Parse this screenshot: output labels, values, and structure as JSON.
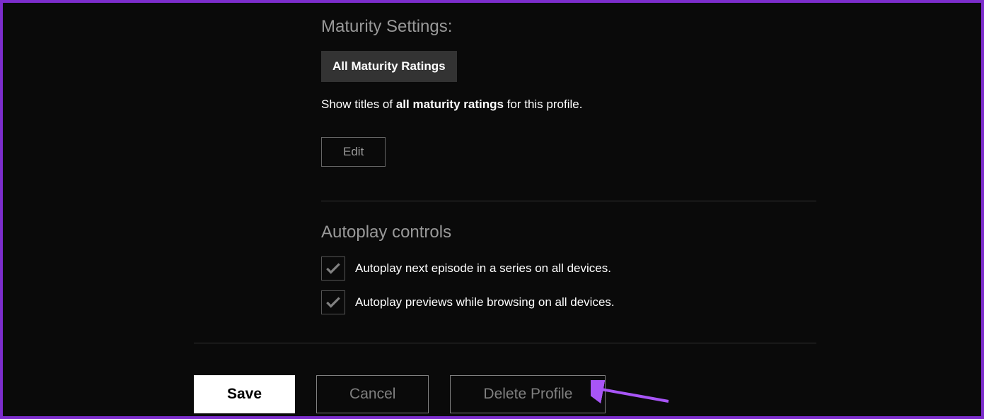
{
  "maturity": {
    "title": "Maturity Settings:",
    "badge": "All Maturity Ratings",
    "desc_prefix": "Show titles of ",
    "desc_strong": "all maturity ratings",
    "desc_suffix": " for this profile.",
    "edit": "Edit"
  },
  "autoplay": {
    "title": "Autoplay controls",
    "option1": "Autoplay next episode in a series on all devices.",
    "option2": "Autoplay previews while browsing on all devices."
  },
  "buttons": {
    "save": "Save",
    "cancel": "Cancel",
    "delete": "Delete Profile"
  }
}
